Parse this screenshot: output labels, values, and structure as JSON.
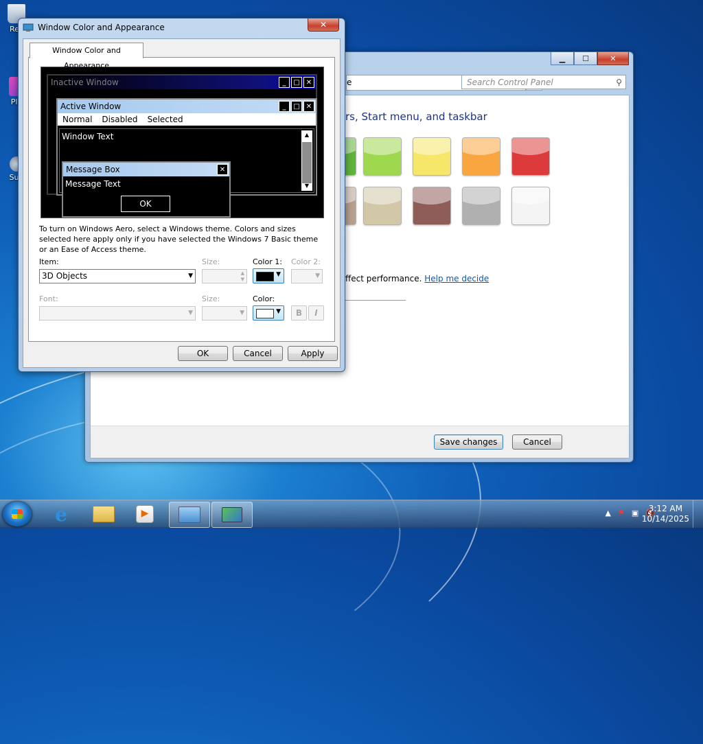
{
  "desktop": {
    "icons": [
      {
        "label": "Rec"
      },
      {
        "label": "Pla"
      },
      {
        "label": "Sup"
      }
    ]
  },
  "control_panel": {
    "address_text": "e",
    "search_placeholder": "Search Control Panel",
    "heading": "rs, Start menu, and taskbar",
    "swatches_row1": [
      "#5fb53a",
      "#9ed84e",
      "#f6e66a",
      "#f9a640",
      "#dd3b3b"
    ],
    "swatches_row2": [
      "#b7a08d",
      "#d2c8a8",
      "#8f5d58",
      "#b0b0b0",
      "#f4f4f4"
    ],
    "performance_text": "ffect performance.",
    "help_link": "Help me decide",
    "save_button": "Save changes",
    "cancel_button": "Cancel"
  },
  "dialog": {
    "title": "Window Color and Appearance",
    "tab_label": "Window Color and Appearance",
    "preview": {
      "inactive_title": "Inactive Window",
      "active_title": "Active Window",
      "menu": [
        "Normal",
        "Disabled",
        "Selected"
      ],
      "window_text": "Window Text",
      "message_title": "Message Box",
      "message_text": "Message Text",
      "ok_label": "OK"
    },
    "description": "To turn on Windows Aero, select a Windows theme.  Colors and sizes selected here apply only if you have selected the Windows 7 Basic theme or an Ease of Access theme.",
    "labels": {
      "item": "Item:",
      "size1": "Size:",
      "color1": "Color 1:",
      "color2": "Color 2:",
      "font": "Font:",
      "size2": "Size:",
      "color": "Color:"
    },
    "item_value": "3D Objects",
    "color1_swatch": "#000000",
    "color_swatch": "#ffffff",
    "bold_label": "B",
    "italic_label": "I",
    "ok_button": "OK",
    "cancel_button": "Cancel",
    "apply_button": "Apply"
  },
  "taskbar": {
    "clock_time": "3:12 AM",
    "clock_date": "10/14/2025"
  }
}
